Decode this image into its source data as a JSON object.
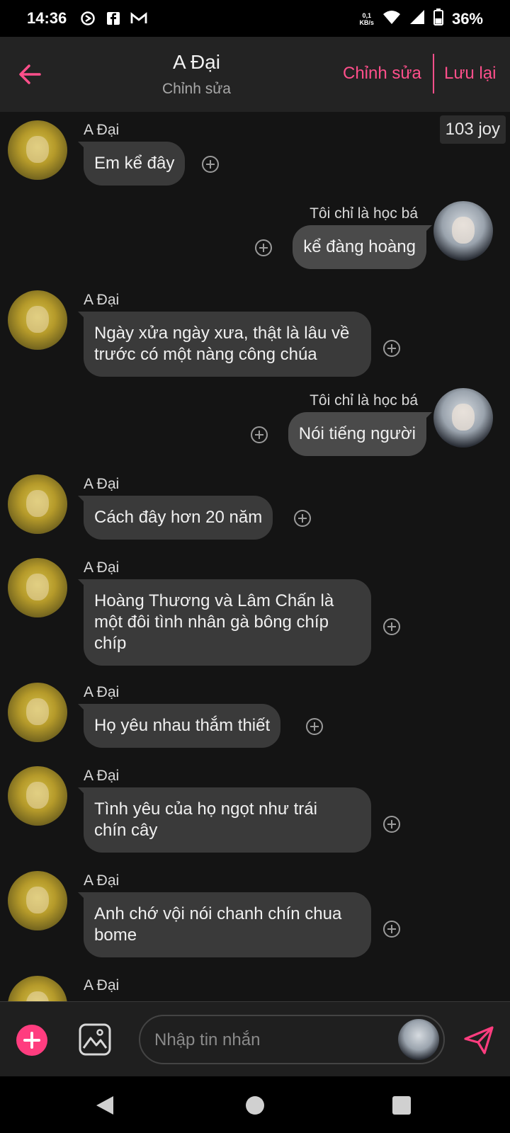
{
  "status": {
    "time": "14:36",
    "net_speed_top": "0,1",
    "net_speed_bottom": "KB/s",
    "battery": "36%",
    "icons": [
      "data-saver-icon",
      "facebook-icon",
      "gmail-icon",
      "wifi-icon",
      "signal-icon",
      "battery-icon"
    ]
  },
  "header": {
    "title": "A Đại",
    "subtitle": "Chỉnh sửa",
    "edit_label": "Chỉnh sửa",
    "save_label": "Lưu lại",
    "accent": "#ff4f8b"
  },
  "chat": {
    "joy_badge": "103 joy",
    "messages": [
      {
        "side": "left",
        "name": "A Đại",
        "text": "Em kể đây"
      },
      {
        "side": "right",
        "name": "Tôi chỉ là học bá",
        "text": "kể đàng hoàng"
      },
      {
        "side": "left",
        "name": "A Đại",
        "text": "Ngày xửa ngày xưa, thật là lâu về\ntrước có một nàng công chúa"
      },
      {
        "side": "right",
        "name": "Tôi chỉ là học bá",
        "text": "Nói tiếng người"
      },
      {
        "side": "left",
        "name": "A Đại",
        "text": "Cách đây hơn 20 năm"
      },
      {
        "side": "left",
        "name": "A Đại",
        "text": "Hoàng Thương và Lâm Chấn là\nmột đôi tình nhân gà bông chíp\nchíp"
      },
      {
        "side": "left",
        "name": "A Đại",
        "text": "Họ yêu nhau thắm thiết"
      },
      {
        "side": "left",
        "name": "A Đại",
        "text": "Tình yêu của họ ngọt như trái\nchín cây"
      },
      {
        "side": "left",
        "name": "A Đại",
        "text": "Anh chớ vội nói chanh chín chua\nbome"
      },
      {
        "side": "left",
        "name": "A Đại",
        "text": ""
      }
    ]
  },
  "input": {
    "placeholder": "Nhập tin nhắn"
  },
  "navbar": {
    "icons": [
      "back-triangle-icon",
      "home-circle-icon",
      "recents-square-icon"
    ]
  }
}
